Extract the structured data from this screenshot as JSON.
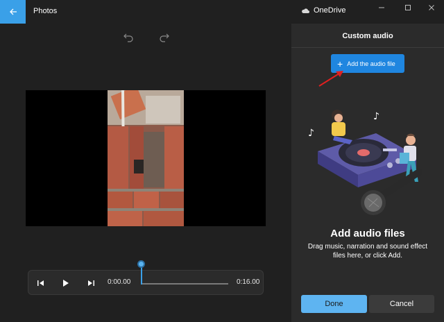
{
  "titlebar": {
    "app_title": "Photos",
    "onedrive_label": "OneDrive",
    "accent_color": "#3aa0e8",
    "icons": [
      "back-arrow-icon",
      "cloud-icon",
      "minimize-icon",
      "maximize-icon",
      "close-icon"
    ]
  },
  "editor": {
    "icons": [
      "undo-icon",
      "redo-icon"
    ],
    "playback": {
      "current_time": "0:00.00",
      "total_time": "0:16.00",
      "progress": 0,
      "icons": [
        "previous-frame-icon",
        "play-icon",
        "next-frame-icon"
      ]
    }
  },
  "panel": {
    "title": "Custom audio",
    "add_button_label": "Add the audio file",
    "heading": "Add audio files",
    "description": "Drag music, narration and sound effect files here, or click Add.",
    "done_label": "Done",
    "cancel_label": "Cancel",
    "primary_color": "#5eb4f1",
    "button_color": "#1f86e0",
    "annotation_arrow_color": "#e02020"
  }
}
